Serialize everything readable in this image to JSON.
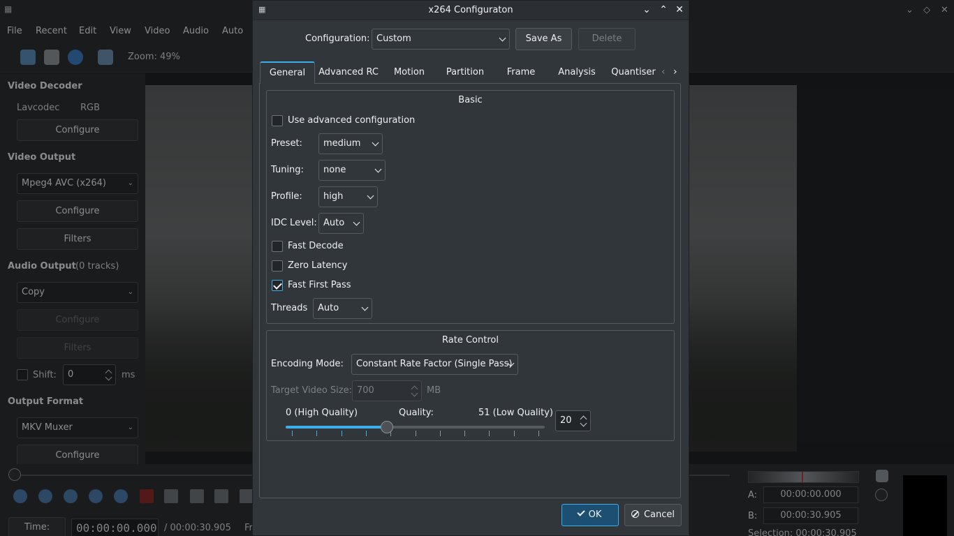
{
  "main": {
    "menu": [
      "File",
      "Recent",
      "Edit",
      "View",
      "Video",
      "Audio",
      "Auto"
    ],
    "zoom": "Zoom: 49%",
    "video_decoder": {
      "heading": "Video Decoder",
      "codec": "Lavcodec",
      "colorspace": "RGB",
      "configure": "Configure"
    },
    "video_output": {
      "heading": "Video Output",
      "codec": "Mpeg4 AVC (x264)",
      "configure": "Configure",
      "filters": "Filters"
    },
    "audio_output": {
      "heading": "Audio Output",
      "tracks": "(0 tracks)",
      "codec": "Copy",
      "configure": "Configure",
      "filters": "Filters",
      "shift_label": "Shift:",
      "shift_value": "0",
      "shift_unit": "ms"
    },
    "output_format": {
      "heading": "Output Format",
      "muxer": "MKV Muxer",
      "configure": "Configure"
    },
    "time_button": "Time:",
    "time_current": "00:00:00.000",
    "time_total": "/ 00:00:30.905",
    "frame_label": "Fr",
    "marker_a_label": "A:",
    "marker_a": "00:00:00.000",
    "marker_b_label": "B:",
    "marker_b": "00:00:30.905",
    "selection": "Selection: 00:00:30.905"
  },
  "dialog": {
    "title": "x264 Configuraton",
    "configuration_label": "Configuration:",
    "configuration_value": "Custom",
    "save_as": "Save As",
    "delete": "Delete",
    "tabs": [
      "General",
      "Advanced RC",
      "Motion",
      "Partition",
      "Frame",
      "Analysis",
      "Quantiser"
    ],
    "active_tab": "General",
    "basic": {
      "title": "Basic",
      "use_advanced": "Use advanced configuration",
      "use_advanced_checked": false,
      "preset_label": "Preset:",
      "preset": "medium",
      "tuning_label": "Tuning:",
      "tuning": "none",
      "profile_label": "Profile:",
      "profile": "high",
      "idc_label": "IDC Level:",
      "idc": "Auto",
      "fast_decode": "Fast Decode",
      "fast_decode_checked": false,
      "zero_latency": "Zero Latency",
      "zero_latency_checked": false,
      "fast_first_pass": "Fast First Pass",
      "fast_first_pass_checked": true,
      "threads_label": "Threads",
      "threads": "Auto"
    },
    "rate_control": {
      "title": "Rate Control",
      "encoding_mode_label": "Encoding Mode:",
      "encoding_mode": "Constant Rate Factor (Single Pass)",
      "target_size_label": "Target Video Size:",
      "target_size": "700",
      "target_size_unit": "MB",
      "quality_min_label": "0 (High Quality)",
      "quality_label": "Quality:",
      "quality_max_label": "51 (Low Quality)",
      "quality_value": "20",
      "quality_min": 0,
      "quality_max": 51,
      "quality": 20
    },
    "ok": "OK",
    "cancel": "Cancel"
  },
  "colors": {
    "accent": "#3daee9",
    "dialog_bg": "#31363b",
    "border": "#555b61"
  }
}
